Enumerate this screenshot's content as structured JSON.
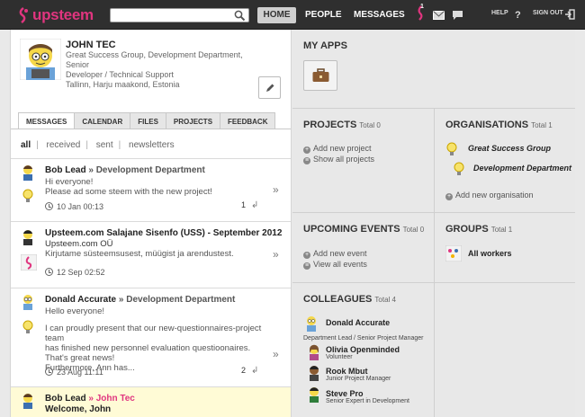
{
  "brand": {
    "name": "upsteem",
    "accent": "#e0357f"
  },
  "search": {
    "placeholder": "",
    "value": ""
  },
  "nav": {
    "home": "HOME",
    "people": "PEOPLE",
    "messages": "MESSAGES",
    "notification_count": "1",
    "help": "HELP",
    "sign_out": "SIGN OUT"
  },
  "profile": {
    "name": "JOHN TEC",
    "line1": "Great Success Group, Development Department, Senior",
    "line2": "Developer / Technical Support",
    "line3": "Tallinn, Harju maakond, Estonia"
  },
  "tabs": [
    "MESSAGES",
    "CALENDAR",
    "FILES",
    "PROJECTS",
    "FEEDBACK"
  ],
  "filters": [
    "all",
    "received",
    "sent",
    "newsletters"
  ],
  "messages": [
    {
      "from": "Bob Lead",
      "arrow": " » ",
      "to": "Development Department",
      "line1": "Hi everyone!",
      "line2": "Please ad some steem with the new project!",
      "date": "10 Jan 00:13",
      "count": "1"
    },
    {
      "from": "Upsteem.com Salajane Sisenfo (USS) - September 2012",
      "org": "Upsteem.com OÜ",
      "line1": "Kirjutame süsteemsusest, müügist ja arendustest.",
      "date": "12 Sep 02:52"
    },
    {
      "from": "Donald Accurate",
      "arrow": " » ",
      "to": "Development Department",
      "line1": "Hello everyone!",
      "line2": "I can proudly present that our new-questionnaires-project team",
      "line3": "has finished new personnel evaluation questioonaires.",
      "line4": "That's great news!",
      "line5": "Furthermore, Ann has...",
      "date": "23 Aug 11:11",
      "count": "2"
    },
    {
      "from": "Bob Lead",
      "arrow": " » ",
      "to": "John Tec",
      "line1": "Welcome, John"
    }
  ],
  "apps": {
    "title": "MY APPS"
  },
  "projects": {
    "title": "PROJECTS",
    "total": "Total 0",
    "add": "Add new project",
    "show": "Show all projects"
  },
  "organisations": {
    "title": "ORGANISATIONS",
    "total": "Total 1",
    "org1": "Great Success Group",
    "org2": "Development Department",
    "add": "Add new organisation"
  },
  "events": {
    "title": "UPCOMING EVENTS",
    "total": "Total 0",
    "add": "Add new event",
    "view": "View all events"
  },
  "groups": {
    "title": "GROUPS",
    "total": "Total 1",
    "group1": "All workers"
  },
  "colleagues": {
    "title": "COLLEAGUES",
    "total": "Total 4",
    "items": [
      {
        "name": "Donald Accurate",
        "role": "Department Lead / Senior Project Manager"
      },
      {
        "name": "Olivia Openminded",
        "role": "Volunteer"
      },
      {
        "name": "Rook Mbut",
        "role": "Junior Project Manager"
      },
      {
        "name": "Steve Pro",
        "role": "Senior Expert in Development"
      }
    ]
  }
}
